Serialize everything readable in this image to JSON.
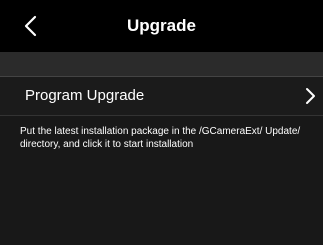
{
  "header": {
    "title": "Upgrade",
    "back_icon": "chevron-left-icon"
  },
  "menu": {
    "items": [
      {
        "label": "Program Upgrade",
        "icon": "chevron-right-icon"
      }
    ]
  },
  "hint_text": "Put the latest installation package in the /GCameraExt/ Update/ directory, and click it to start installation",
  "colors": {
    "header_bg": "#000000",
    "body_bg": "#181818",
    "spacer_bg": "#2b2b2b",
    "text": "#ffffff"
  }
}
